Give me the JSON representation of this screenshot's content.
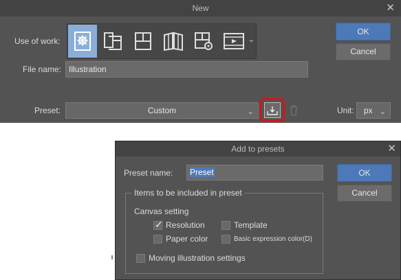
{
  "new_dialog": {
    "title": "New",
    "use_of_work_label": "Use of work:",
    "use_of_work_icons": [
      "illustration-icon",
      "webtoon-icon",
      "comic-icon",
      "book-icon",
      "settings-page-icon",
      "animation-icon"
    ],
    "selected_use": 0,
    "file_name_label": "File name:",
    "file_name_value": "Illustration",
    "preset_label": "Preset:",
    "preset_value": "Custom",
    "unit_label": "Unit:",
    "unit_value": "px",
    "ok_label": "OK",
    "cancel_label": "Cancel"
  },
  "add_to_presets": {
    "title": "Add to presets",
    "preset_name_label": "Preset name:",
    "preset_name_value": "Preset",
    "ok_label": "OK",
    "cancel_label": "Cancel",
    "group_title": "Items to be included in preset",
    "canvas_setting_label": "Canvas setting",
    "checkboxes": {
      "resolution": {
        "label": "Resolution",
        "checked": true
      },
      "template": {
        "label": "Template",
        "checked": false
      },
      "paper_color": {
        "label": "Paper color",
        "checked": false
      },
      "basic_expression_color": {
        "label": "Basic expression color(D)",
        "checked": false
      },
      "moving_illustration": {
        "label": "Moving illustration settings",
        "checked": false
      }
    }
  },
  "colors": {
    "dialog_bg": "#535353",
    "titlebar_bg": "#434343",
    "accent_blue": "#4e79b8",
    "highlight_red": "#d01818",
    "selected_use_bg": "#8aaed8"
  }
}
